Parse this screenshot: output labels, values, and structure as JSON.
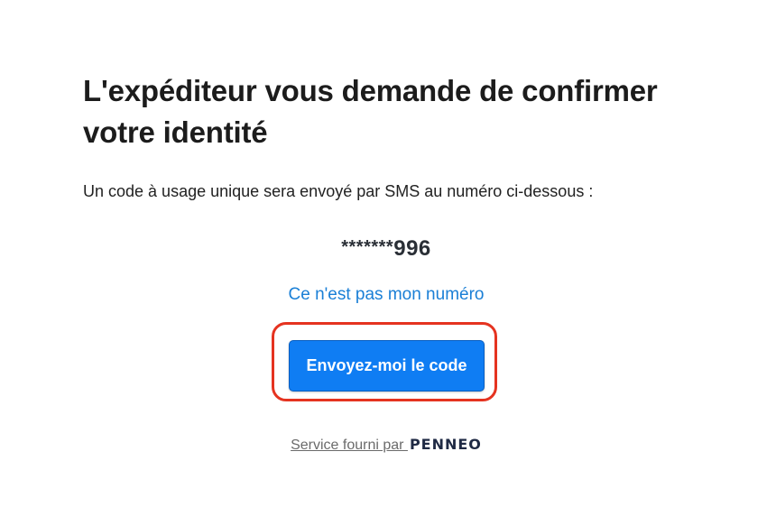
{
  "title": "L'expéditeur vous demande de confirmer votre identité",
  "subtitle": "Un code à usage unique sera envoyé par SMS au numéro ci-dessous :",
  "phone": {
    "mask": "*******",
    "digits": "996"
  },
  "not_my_number_link": "Ce n'est pas mon numéro",
  "send_button_label": "Envoyez-moi le code",
  "footer": {
    "service_text": "Service fourni par ",
    "brand": "PENNEO"
  },
  "colors": {
    "accent": "#0f7df3",
    "link": "#1a7fd6",
    "highlight": "#e53320"
  }
}
